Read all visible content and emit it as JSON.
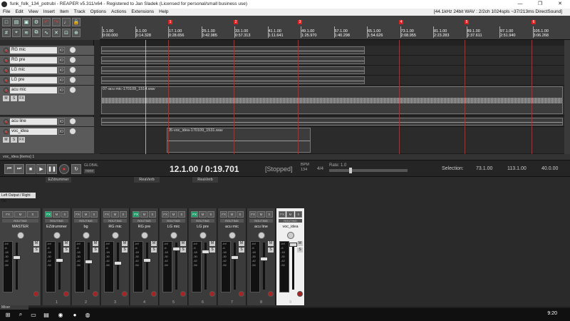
{
  "window": {
    "title": "funk_folk_134_potrubi - REAPER v5.311/x64 - Registered to Jan Sladek (Licensed for personal/small business use)",
    "controls": [
      "—",
      "❐",
      "✕"
    ]
  },
  "menu": {
    "items": [
      "File",
      "Edit",
      "View",
      "Insert",
      "Item",
      "Track",
      "Options",
      "Actions",
      "Extensions",
      "Help"
    ],
    "status": "[44.1kHz 24bit WAV : 2/2ch 1024spls ~37/213ms DirectSound]"
  },
  "ruler": {
    "ticks": [
      {
        "bar": "1.1.00",
        "time": "0:00.000"
      },
      {
        "bar": "9.1.00",
        "time": "0:14.328"
      },
      {
        "bar": "17.1.00",
        "time": "0:28.656"
      },
      {
        "bar": "25.1.00",
        "time": "0:42.985"
      },
      {
        "bar": "33.1.00",
        "time": "0:57.313"
      },
      {
        "bar": "41.1.00",
        "time": "1:11.641"
      },
      {
        "bar": "49.1.00",
        "time": "1:25.970"
      },
      {
        "bar": "57.1.00",
        "time": "1:40.298"
      },
      {
        "bar": "65.1.00",
        "time": "1:54.626"
      },
      {
        "bar": "73.1.00",
        "time": "2:08.955"
      },
      {
        "bar": "81.1.00",
        "time": "2:23.283"
      },
      {
        "bar": "89.1.00",
        "time": "2:37.611"
      },
      {
        "bar": "97.1.00",
        "time": "2:51.940"
      },
      {
        "bar": "105.1.00",
        "time": "3:06.268"
      }
    ],
    "markers": [
      "1",
      "2",
      "3",
      "4",
      "5",
      "6"
    ]
  },
  "tracks": [
    {
      "name": "RG mic"
    },
    {
      "name": "RG pre"
    },
    {
      "name": "LG mic"
    },
    {
      "name": "LG pre"
    },
    {
      "name": "acu mic",
      "item": "07-acu mic-170109_1514.wav"
    },
    {
      "name": "acu line"
    },
    {
      "name": "voc_idea",
      "item": "05-voc_idea-170109_1531.wav"
    }
  ],
  "track_buttons": {
    "m": "M",
    "s": "S",
    "fx": "FX",
    "io": "IO"
  },
  "transport": {
    "time": "12.1.00 / 0:19.701",
    "state": "[Stopped]",
    "bpm_label": "BPM",
    "bpm": "134",
    "sig": "4/4",
    "rate_label": "Rate:",
    "rate": "1.0",
    "selection_label": "Selection:",
    "sel_start": "73.1.00",
    "sel_end": "113.1.00",
    "sel_len": "40.0.00",
    "global": "GLOBAL",
    "global_val": "none",
    "panel_title": "voc_idea [items] 1"
  },
  "mixer": {
    "group_labels": [
      "EZdrummer",
      "ReaVerb",
      "ReaVerb"
    ],
    "io_label": "Left Output / Right Ou",
    "route_label": "ROUTING",
    "strips": [
      {
        "name": "MASTER",
        "num": ""
      },
      {
        "name": "EZdrummer",
        "num": "1"
      },
      {
        "name": "bg",
        "num": "2"
      },
      {
        "name": "RG mic",
        "num": "3"
      },
      {
        "name": "RG pre",
        "num": "4"
      },
      {
        "name": "LG mic",
        "num": "5"
      },
      {
        "name": "LG pre",
        "num": "6"
      },
      {
        "name": "acu mic",
        "num": "7"
      },
      {
        "name": "acu line",
        "num": "8"
      },
      {
        "name": "voc_idea",
        "num": "9"
      }
    ],
    "meter_scale": [
      "-inf",
      "-6",
      "-18",
      "-30",
      "-42",
      "-54"
    ],
    "tab": "Mixer"
  },
  "taskbar": {
    "clock": "9:20"
  }
}
